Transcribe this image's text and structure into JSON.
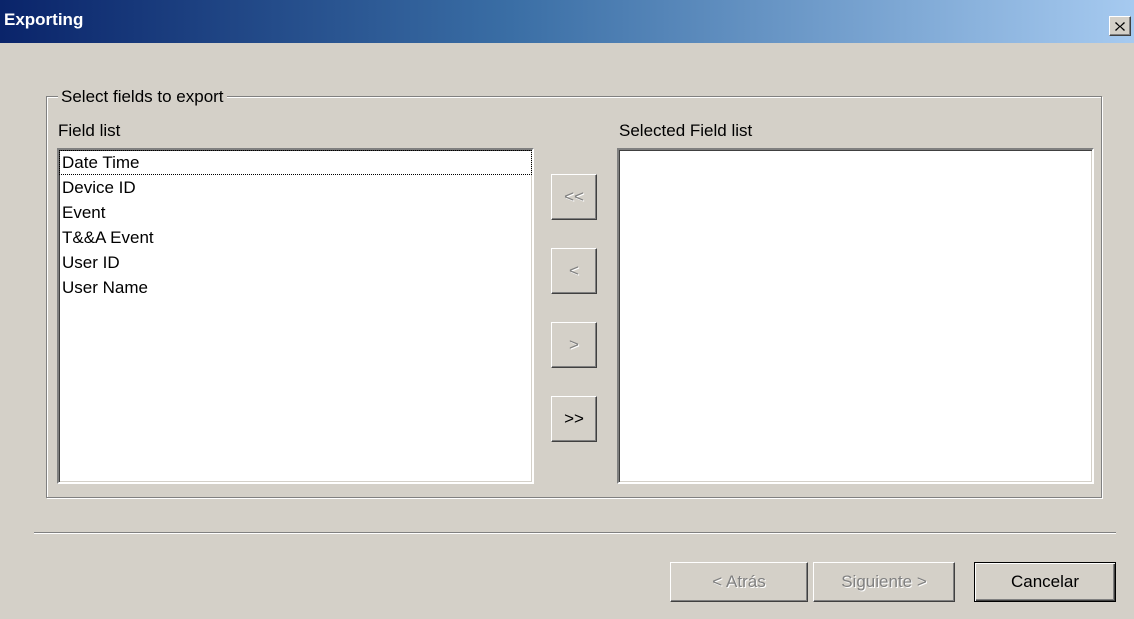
{
  "window": {
    "title": "Exporting",
    "close_icon": "close-icon"
  },
  "group": {
    "legend": "Select fields to export"
  },
  "field_list": {
    "label": "Field list",
    "items": [
      "Date Time",
      "Device ID",
      "Event",
      "T&&A Event",
      "User ID",
      "User Name"
    ],
    "focused_index": 0
  },
  "selected_list": {
    "label": "Selected Field list",
    "items": []
  },
  "transfer_buttons": {
    "remove_all": "<<",
    "remove_one": "<",
    "add_one": ">",
    "add_all": ">>"
  },
  "footer": {
    "back_label": "< Atrás",
    "next_label": "Siguiente >",
    "cancel_label": "Cancelar"
  }
}
